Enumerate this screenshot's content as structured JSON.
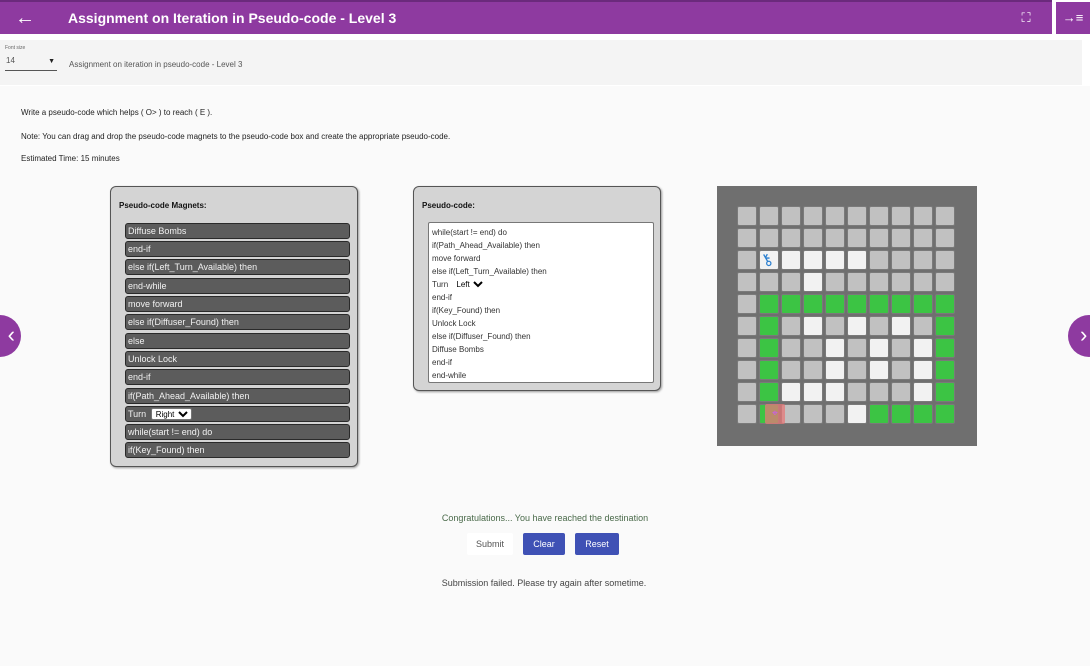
{
  "header": {
    "title": "Assignment on Iteration in Pseudo-code - Level 3",
    "back_icon": "arrow-left-icon",
    "fullscreen_icon": "fullscreen-icon",
    "side_icon": "collapse-panel-icon",
    "accent": "#8e3aa0"
  },
  "toolbar": {
    "font_size_label": "Font size",
    "font_size_value": "14",
    "title": "Assignment on iteration in pseudo-code - Level 3"
  },
  "instructions": {
    "line1": "Write a pseudo-code which helps ( O> ) to reach ( E ).",
    "line2": "Note: You can drag and drop the pseudo-code magnets to the pseudo-code box and create the appropriate pseudo-code.",
    "line3": "Estimated Time: 15 minutes"
  },
  "magnets": {
    "header": "Pseudo-code Magnets:",
    "items": [
      "Diffuse Bombs",
      "end-if",
      "else if(Left_Turn_Available) then",
      "end-while",
      "move forward",
      "else if(Diffuser_Found) then",
      "else",
      "Unlock Lock",
      "end-if",
      "if(Path_Ahead_Available) then",
      "Turn",
      "while(start != end) do",
      "if(Key_Found) then"
    ],
    "turn_select": "Right"
  },
  "code": {
    "header": "Pseudo-code:",
    "lines": [
      "while(start != end) do",
      "if(Path_Ahead_Available) then",
      "move forward",
      "else if(Left_Turn_Available) then",
      "Turn",
      "end-if",
      "if(Key_Found) then",
      "Unlock Lock",
      "else if(Diffuser_Found) then",
      "Diffuse Bombs",
      "end-if",
      "end-while"
    ],
    "turn_select": "Left"
  },
  "maze": {
    "rows": [
      "gggggggggg",
      "gggggggggg",
      "gwwwwwgggg",
      "gggwgggggg",
      "gnnnnnnnnn",
      "gngwgwgwgn",
      "gnggwgwgwn",
      "gnggwgwgwn",
      "gnwwwgggwn",
      "gngggwnnnn"
    ],
    "key_icon": "key-icon",
    "key_color": "#2a7fd0",
    "wall_color": "#c1c1c1",
    "open_color": "#f2f2f2",
    "path_color": "#3cc444"
  },
  "nav": {
    "prev_icon": "chevron-left-icon",
    "next_icon": "chevron-right-icon"
  },
  "status": {
    "congrats": "Congratulations... You have reached the destination",
    "failure": "Submission failed. Please try again after sometime."
  },
  "buttons": {
    "submit": "Submit",
    "clear": "Clear",
    "reset": "Reset"
  }
}
